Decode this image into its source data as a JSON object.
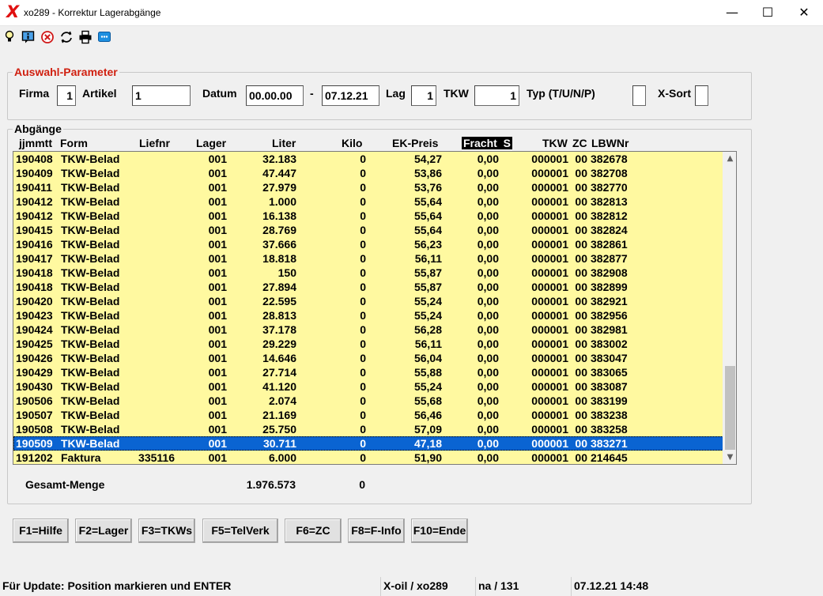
{
  "window": {
    "title": "xo289 - Korrektur Lagerabgänge",
    "min_glyph": "—",
    "max_glyph": "☐",
    "close_glyph": "✕"
  },
  "toolbar": {
    "icons": [
      "lightbulb-icon",
      "info-icon",
      "cancel-icon",
      "refresh-icon",
      "printer-icon",
      "chat-icon"
    ]
  },
  "params": {
    "title": "Auswahl-Parameter",
    "firma_label": "Firma",
    "firma_value": "1",
    "artikel_label": "Artikel",
    "artikel_value": "1",
    "datum_label": "Datum",
    "datum_from": "00.00.00",
    "datum_sep": "-",
    "datum_to": "07.12.21",
    "lag_label": "Lag",
    "lag_value": "1",
    "tkw_label": "TKW",
    "tkw_value": "1",
    "typ_label": "Typ (T/U/N/P)",
    "typ_value": "",
    "xsort_label": "X-Sort",
    "xsort_value": ""
  },
  "abgaenge": {
    "title": "Abgänge",
    "columns": {
      "jjmmtt": "jjmmtt",
      "form": "Form",
      "liefnr": "Liefnr",
      "lager": "Lager",
      "liter": "Liter",
      "kilo": "Kilo",
      "ekpreis": "EK-Preis",
      "fracht": "Fracht  S",
      "tkw": "TKW",
      "zc": "ZC",
      "lbwnr": "LBWNr"
    },
    "rows": [
      {
        "date": "190408",
        "form": "TKW-Belad",
        "liefnr": "",
        "lager": "001",
        "liter": "32.183",
        "kilo": "0",
        "ek": "54,27",
        "fracht": "0,00",
        "tkw": "000001",
        "zc": "00",
        "lbw": "382678"
      },
      {
        "date": "190409",
        "form": "TKW-Belad",
        "liefnr": "",
        "lager": "001",
        "liter": "47.447",
        "kilo": "0",
        "ek": "53,86",
        "fracht": "0,00",
        "tkw": "000001",
        "zc": "00",
        "lbw": "382708"
      },
      {
        "date": "190411",
        "form": "TKW-Belad",
        "liefnr": "",
        "lager": "001",
        "liter": "27.979",
        "kilo": "0",
        "ek": "53,76",
        "fracht": "0,00",
        "tkw": "000001",
        "zc": "00",
        "lbw": "382770"
      },
      {
        "date": "190412",
        "form": "TKW-Belad",
        "liefnr": "",
        "lager": "001",
        "liter": "1.000",
        "kilo": "0",
        "ek": "55,64",
        "fracht": "0,00",
        "tkw": "000001",
        "zc": "00",
        "lbw": "382813"
      },
      {
        "date": "190412",
        "form": "TKW-Belad",
        "liefnr": "",
        "lager": "001",
        "liter": "16.138",
        "kilo": "0",
        "ek": "55,64",
        "fracht": "0,00",
        "tkw": "000001",
        "zc": "00",
        "lbw": "382812"
      },
      {
        "date": "190415",
        "form": "TKW-Belad",
        "liefnr": "",
        "lager": "001",
        "liter": "28.769",
        "kilo": "0",
        "ek": "55,64",
        "fracht": "0,00",
        "tkw": "000001",
        "zc": "00",
        "lbw": "382824"
      },
      {
        "date": "190416",
        "form": "TKW-Belad",
        "liefnr": "",
        "lager": "001",
        "liter": "37.666",
        "kilo": "0",
        "ek": "56,23",
        "fracht": "0,00",
        "tkw": "000001",
        "zc": "00",
        "lbw": "382861"
      },
      {
        "date": "190417",
        "form": "TKW-Belad",
        "liefnr": "",
        "lager": "001",
        "liter": "18.818",
        "kilo": "0",
        "ek": "56,11",
        "fracht": "0,00",
        "tkw": "000001",
        "zc": "00",
        "lbw": "382877"
      },
      {
        "date": "190418",
        "form": "TKW-Belad",
        "liefnr": "",
        "lager": "001",
        "liter": "150",
        "kilo": "0",
        "ek": "55,87",
        "fracht": "0,00",
        "tkw": "000001",
        "zc": "00",
        "lbw": "382908"
      },
      {
        "date": "190418",
        "form": "TKW-Belad",
        "liefnr": "",
        "lager": "001",
        "liter": "27.894",
        "kilo": "0",
        "ek": "55,87",
        "fracht": "0,00",
        "tkw": "000001",
        "zc": "00",
        "lbw": "382899"
      },
      {
        "date": "190420",
        "form": "TKW-Belad",
        "liefnr": "",
        "lager": "001",
        "liter": "22.595",
        "kilo": "0",
        "ek": "55,24",
        "fracht": "0,00",
        "tkw": "000001",
        "zc": "00",
        "lbw": "382921"
      },
      {
        "date": "190423",
        "form": "TKW-Belad",
        "liefnr": "",
        "lager": "001",
        "liter": "28.813",
        "kilo": "0",
        "ek": "55,24",
        "fracht": "0,00",
        "tkw": "000001",
        "zc": "00",
        "lbw": "382956"
      },
      {
        "date": "190424",
        "form": "TKW-Belad",
        "liefnr": "",
        "lager": "001",
        "liter": "37.178",
        "kilo": "0",
        "ek": "56,28",
        "fracht": "0,00",
        "tkw": "000001",
        "zc": "00",
        "lbw": "382981"
      },
      {
        "date": "190425",
        "form": "TKW-Belad",
        "liefnr": "",
        "lager": "001",
        "liter": "29.229",
        "kilo": "0",
        "ek": "56,11",
        "fracht": "0,00",
        "tkw": "000001",
        "zc": "00",
        "lbw": "383002"
      },
      {
        "date": "190426",
        "form": "TKW-Belad",
        "liefnr": "",
        "lager": "001",
        "liter": "14.646",
        "kilo": "0",
        "ek": "56,04",
        "fracht": "0,00",
        "tkw": "000001",
        "zc": "00",
        "lbw": "383047"
      },
      {
        "date": "190429",
        "form": "TKW-Belad",
        "liefnr": "",
        "lager": "001",
        "liter": "27.714",
        "kilo": "0",
        "ek": "55,88",
        "fracht": "0,00",
        "tkw": "000001",
        "zc": "00",
        "lbw": "383065"
      },
      {
        "date": "190430",
        "form": "TKW-Belad",
        "liefnr": "",
        "lager": "001",
        "liter": "41.120",
        "kilo": "0",
        "ek": "55,24",
        "fracht": "0,00",
        "tkw": "000001",
        "zc": "00",
        "lbw": "383087"
      },
      {
        "date": "190506",
        "form": "TKW-Belad",
        "liefnr": "",
        "lager": "001",
        "liter": "2.074",
        "kilo": "0",
        "ek": "55,68",
        "fracht": "0,00",
        "tkw": "000001",
        "zc": "00",
        "lbw": "383199"
      },
      {
        "date": "190507",
        "form": "TKW-Belad",
        "liefnr": "",
        "lager": "001",
        "liter": "21.169",
        "kilo": "0",
        "ek": "56,46",
        "fracht": "0,00",
        "tkw": "000001",
        "zc": "00",
        "lbw": "383238"
      },
      {
        "date": "190508",
        "form": "TKW-Belad",
        "liefnr": "",
        "lager": "001",
        "liter": "25.750",
        "kilo": "0",
        "ek": "57,09",
        "fracht": "0,00",
        "tkw": "000001",
        "zc": "00",
        "lbw": "383258"
      },
      {
        "date": "190509",
        "form": "TKW-Belad",
        "liefnr": "",
        "lager": "001",
        "liter": "30.711",
        "kilo": "0",
        "ek": "47,18",
        "fracht": "0,00",
        "tkw": "000001",
        "zc": "00",
        "lbw": "383271",
        "selected": true
      },
      {
        "date": "191202",
        "form": "Faktura",
        "liefnr": "335116",
        "lager": "001",
        "liter": "6.000",
        "kilo": "0",
        "ek": "51,90",
        "fracht": "0,00",
        "tkw": "000001",
        "zc": "00",
        "lbw": "214645"
      }
    ],
    "total_label": "Gesamt-Menge",
    "total_liter": "1.976.573",
    "total_kilo": "0"
  },
  "fkeys": [
    "F1=Hilfe",
    "F2=Lager",
    "F3=TKWs",
    "F5=TelVerk",
    "F6=ZC",
    "F8=F-Info",
    "F10=Ende"
  ],
  "status": {
    "message": "Für Update: Position markieren und ENTER",
    "app": "X-oil / xo289",
    "user": "na / 131",
    "datetime": "07.12.21 14:48"
  },
  "colors": {
    "list_bg": "#fff9a0",
    "selection": "#0a64d2",
    "group_title": "#d02010"
  }
}
